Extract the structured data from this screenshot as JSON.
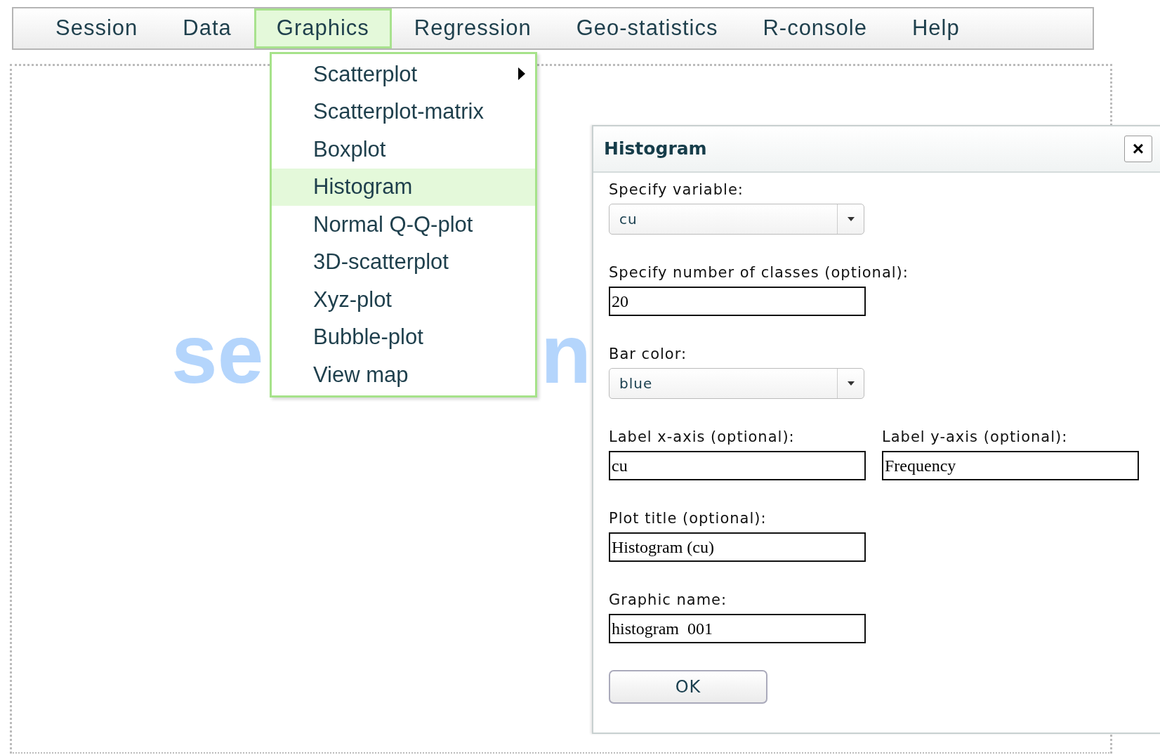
{
  "menu_bar": [
    {
      "label": "Session",
      "selected": false
    },
    {
      "label": "Data",
      "selected": false
    },
    {
      "label": "Graphics",
      "selected": true
    },
    {
      "label": "Regression",
      "selected": false
    },
    {
      "label": "Geo-statistics",
      "selected": false
    },
    {
      "label": "R-console",
      "selected": false
    },
    {
      "label": "Help",
      "selected": false
    }
  ],
  "dropdown": [
    {
      "label": "Scatterplot",
      "selected": false,
      "submenu": true
    },
    {
      "label": "Scatterplot-matrix",
      "selected": false,
      "submenu": false
    },
    {
      "label": "Boxplot",
      "selected": false,
      "submenu": false
    },
    {
      "label": "Histogram",
      "selected": true,
      "submenu": false
    },
    {
      "label": "Normal Q-Q-plot",
      "selected": false,
      "submenu": false
    },
    {
      "label": "3D-scatterplot",
      "selected": false,
      "submenu": false
    },
    {
      "label": "Xyz-plot",
      "selected": false,
      "submenu": false
    },
    {
      "label": "Bubble-plot",
      "selected": false,
      "submenu": false
    },
    {
      "label": "View map",
      "selected": false,
      "submenu": false
    }
  ],
  "background_logo": {
    "left": "se",
    "right": "n"
  },
  "dialog": {
    "title": "Histogram",
    "close": "×",
    "rows": [
      {
        "kind": "single",
        "fields": [
          {
            "kind": "select",
            "label": "Specify variable:",
            "value": "cu"
          }
        ]
      },
      {
        "kind": "single",
        "fields": [
          {
            "kind": "text",
            "label": "Specify number of classes (optional):",
            "value": "20"
          }
        ]
      },
      {
        "kind": "single",
        "fields": [
          {
            "kind": "select",
            "label": "Bar color:",
            "value": "blue"
          }
        ]
      },
      {
        "kind": "pair",
        "fields": [
          {
            "kind": "text",
            "label": "Label x-axis (optional):",
            "value": "cu"
          },
          {
            "kind": "text",
            "label": "Label y-axis (optional):",
            "value": "Frequency"
          }
        ]
      },
      {
        "kind": "single",
        "fields": [
          {
            "kind": "text",
            "label": "Plot title (optional):",
            "value": "Histogram (cu)"
          }
        ]
      },
      {
        "kind": "single",
        "fields": [
          {
            "kind": "text",
            "label": "Graphic name:",
            "value": "histogram  001"
          }
        ]
      }
    ],
    "ok": "OK"
  }
}
